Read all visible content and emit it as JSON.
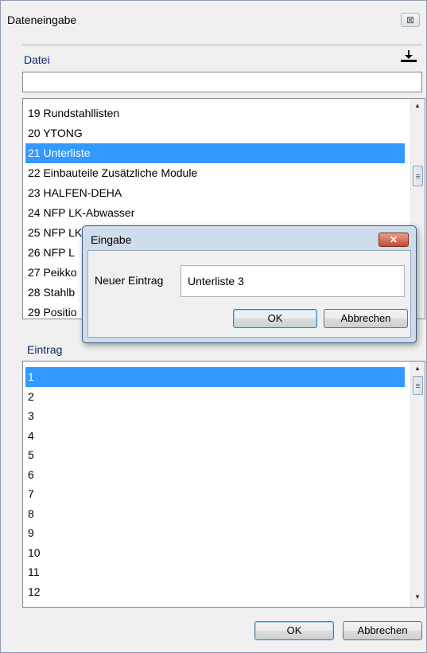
{
  "window": {
    "title": "Dateneingabe",
    "close_glyph": "⊠"
  },
  "datei": {
    "label": "Datei",
    "value": "",
    "upload_icon": "upload-tray-icon"
  },
  "list1": {
    "items": [
      "19 Rundstahllisten",
      "20 YTONG",
      "21 Unterliste",
      "22 Einbauteile Zusätzliche Module",
      "23 HALFEN-DEHA",
      "24 NFP LK-Abwasser",
      "25 NFP LK-Wasser",
      "26 NFP L",
      "27 Peikko",
      "28 Stahlb",
      "29 Positio"
    ],
    "selected_index": 2
  },
  "eintrag": {
    "label": "Eintrag"
  },
  "list2": {
    "items": [
      "1",
      "2",
      "3",
      "4",
      "5",
      "6",
      "7",
      "8",
      "9",
      "10",
      "11",
      "12"
    ],
    "selected_index": 0
  },
  "buttons": {
    "ok": "OK",
    "cancel": "Abbrechen"
  },
  "dialog": {
    "title": "Eingabe",
    "field_label": "Neuer Eintrag",
    "field_value": "Unterliste 3",
    "ok": "OK",
    "cancel": "Abbrechen",
    "close_glyph": "✕"
  },
  "colors": {
    "selection": "#3399ff",
    "label_blue": "#0a2a6a",
    "dialog_frame": "#cfdcec"
  }
}
